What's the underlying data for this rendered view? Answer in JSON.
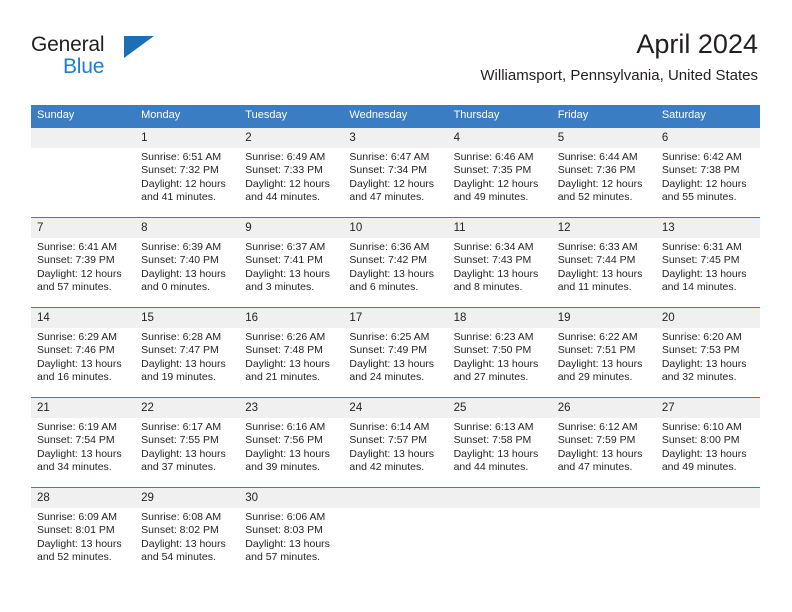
{
  "logo": {
    "name_part1": "General",
    "name_part2": "Blue",
    "triangle_color": "#1b6fb5",
    "blue_color": "#1d7fd1"
  },
  "header": {
    "title": "April 2024",
    "subtitle": "Williamsport, Pennsylvania, United States",
    "header_bg": "#3a7dc2",
    "daynum_bg": "#f0f0f0"
  },
  "weekday_headers": [
    "Sunday",
    "Monday",
    "Tuesday",
    "Wednesday",
    "Thursday",
    "Friday",
    "Saturday"
  ],
  "weeks": [
    [
      {
        "day": "",
        "sunrise": "",
        "sunset": "",
        "daylight_line1": "",
        "daylight_line2": ""
      },
      {
        "day": "1",
        "sunrise": "Sunrise: 6:51 AM",
        "sunset": "Sunset: 7:32 PM",
        "daylight_line1": "Daylight: 12 hours",
        "daylight_line2": "and 41 minutes."
      },
      {
        "day": "2",
        "sunrise": "Sunrise: 6:49 AM",
        "sunset": "Sunset: 7:33 PM",
        "daylight_line1": "Daylight: 12 hours",
        "daylight_line2": "and 44 minutes."
      },
      {
        "day": "3",
        "sunrise": "Sunrise: 6:47 AM",
        "sunset": "Sunset: 7:34 PM",
        "daylight_line1": "Daylight: 12 hours",
        "daylight_line2": "and 47 minutes."
      },
      {
        "day": "4",
        "sunrise": "Sunrise: 6:46 AM",
        "sunset": "Sunset: 7:35 PM",
        "daylight_line1": "Daylight: 12 hours",
        "daylight_line2": "and 49 minutes."
      },
      {
        "day": "5",
        "sunrise": "Sunrise: 6:44 AM",
        "sunset": "Sunset: 7:36 PM",
        "daylight_line1": "Daylight: 12 hours",
        "daylight_line2": "and 52 minutes."
      },
      {
        "day": "6",
        "sunrise": "Sunrise: 6:42 AM",
        "sunset": "Sunset: 7:38 PM",
        "daylight_line1": "Daylight: 12 hours",
        "daylight_line2": "and 55 minutes."
      }
    ],
    [
      {
        "day": "7",
        "sunrise": "Sunrise: 6:41 AM",
        "sunset": "Sunset: 7:39 PM",
        "daylight_line1": "Daylight: 12 hours",
        "daylight_line2": "and 57 minutes."
      },
      {
        "day": "8",
        "sunrise": "Sunrise: 6:39 AM",
        "sunset": "Sunset: 7:40 PM",
        "daylight_line1": "Daylight: 13 hours",
        "daylight_line2": "and 0 minutes."
      },
      {
        "day": "9",
        "sunrise": "Sunrise: 6:37 AM",
        "sunset": "Sunset: 7:41 PM",
        "daylight_line1": "Daylight: 13 hours",
        "daylight_line2": "and 3 minutes."
      },
      {
        "day": "10",
        "sunrise": "Sunrise: 6:36 AM",
        "sunset": "Sunset: 7:42 PM",
        "daylight_line1": "Daylight: 13 hours",
        "daylight_line2": "and 6 minutes."
      },
      {
        "day": "11",
        "sunrise": "Sunrise: 6:34 AM",
        "sunset": "Sunset: 7:43 PM",
        "daylight_line1": "Daylight: 13 hours",
        "daylight_line2": "and 8 minutes."
      },
      {
        "day": "12",
        "sunrise": "Sunrise: 6:33 AM",
        "sunset": "Sunset: 7:44 PM",
        "daylight_line1": "Daylight: 13 hours",
        "daylight_line2": "and 11 minutes."
      },
      {
        "day": "13",
        "sunrise": "Sunrise: 6:31 AM",
        "sunset": "Sunset: 7:45 PM",
        "daylight_line1": "Daylight: 13 hours",
        "daylight_line2": "and 14 minutes."
      }
    ],
    [
      {
        "day": "14",
        "sunrise": "Sunrise: 6:29 AM",
        "sunset": "Sunset: 7:46 PM",
        "daylight_line1": "Daylight: 13 hours",
        "daylight_line2": "and 16 minutes."
      },
      {
        "day": "15",
        "sunrise": "Sunrise: 6:28 AM",
        "sunset": "Sunset: 7:47 PM",
        "daylight_line1": "Daylight: 13 hours",
        "daylight_line2": "and 19 minutes."
      },
      {
        "day": "16",
        "sunrise": "Sunrise: 6:26 AM",
        "sunset": "Sunset: 7:48 PM",
        "daylight_line1": "Daylight: 13 hours",
        "daylight_line2": "and 21 minutes."
      },
      {
        "day": "17",
        "sunrise": "Sunrise: 6:25 AM",
        "sunset": "Sunset: 7:49 PM",
        "daylight_line1": "Daylight: 13 hours",
        "daylight_line2": "and 24 minutes."
      },
      {
        "day": "18",
        "sunrise": "Sunrise: 6:23 AM",
        "sunset": "Sunset: 7:50 PM",
        "daylight_line1": "Daylight: 13 hours",
        "daylight_line2": "and 27 minutes."
      },
      {
        "day": "19",
        "sunrise": "Sunrise: 6:22 AM",
        "sunset": "Sunset: 7:51 PM",
        "daylight_line1": "Daylight: 13 hours",
        "daylight_line2": "and 29 minutes."
      },
      {
        "day": "20",
        "sunrise": "Sunrise: 6:20 AM",
        "sunset": "Sunset: 7:53 PM",
        "daylight_line1": "Daylight: 13 hours",
        "daylight_line2": "and 32 minutes."
      }
    ],
    [
      {
        "day": "21",
        "sunrise": "Sunrise: 6:19 AM",
        "sunset": "Sunset: 7:54 PM",
        "daylight_line1": "Daylight: 13 hours",
        "daylight_line2": "and 34 minutes."
      },
      {
        "day": "22",
        "sunrise": "Sunrise: 6:17 AM",
        "sunset": "Sunset: 7:55 PM",
        "daylight_line1": "Daylight: 13 hours",
        "daylight_line2": "and 37 minutes."
      },
      {
        "day": "23",
        "sunrise": "Sunrise: 6:16 AM",
        "sunset": "Sunset: 7:56 PM",
        "daylight_line1": "Daylight: 13 hours",
        "daylight_line2": "and 39 minutes."
      },
      {
        "day": "24",
        "sunrise": "Sunrise: 6:14 AM",
        "sunset": "Sunset: 7:57 PM",
        "daylight_line1": "Daylight: 13 hours",
        "daylight_line2": "and 42 minutes."
      },
      {
        "day": "25",
        "sunrise": "Sunrise: 6:13 AM",
        "sunset": "Sunset: 7:58 PM",
        "daylight_line1": "Daylight: 13 hours",
        "daylight_line2": "and 44 minutes."
      },
      {
        "day": "26",
        "sunrise": "Sunrise: 6:12 AM",
        "sunset": "Sunset: 7:59 PM",
        "daylight_line1": "Daylight: 13 hours",
        "daylight_line2": "and 47 minutes."
      },
      {
        "day": "27",
        "sunrise": "Sunrise: 6:10 AM",
        "sunset": "Sunset: 8:00 PM",
        "daylight_line1": "Daylight: 13 hours",
        "daylight_line2": "and 49 minutes."
      }
    ],
    [
      {
        "day": "28",
        "sunrise": "Sunrise: 6:09 AM",
        "sunset": "Sunset: 8:01 PM",
        "daylight_line1": "Daylight: 13 hours",
        "daylight_line2": "and 52 minutes."
      },
      {
        "day": "29",
        "sunrise": "Sunrise: 6:08 AM",
        "sunset": "Sunset: 8:02 PM",
        "daylight_line1": "Daylight: 13 hours",
        "daylight_line2": "and 54 minutes."
      },
      {
        "day": "30",
        "sunrise": "Sunrise: 6:06 AM",
        "sunset": "Sunset: 8:03 PM",
        "daylight_line1": "Daylight: 13 hours",
        "daylight_line2": "and 57 minutes."
      },
      {
        "day": "",
        "sunrise": "",
        "sunset": "",
        "daylight_line1": "",
        "daylight_line2": ""
      },
      {
        "day": "",
        "sunrise": "",
        "sunset": "",
        "daylight_line1": "",
        "daylight_line2": ""
      },
      {
        "day": "",
        "sunrise": "",
        "sunset": "",
        "daylight_line1": "",
        "daylight_line2": ""
      },
      {
        "day": "",
        "sunrise": "",
        "sunset": "",
        "daylight_line1": "",
        "daylight_line2": ""
      }
    ]
  ]
}
